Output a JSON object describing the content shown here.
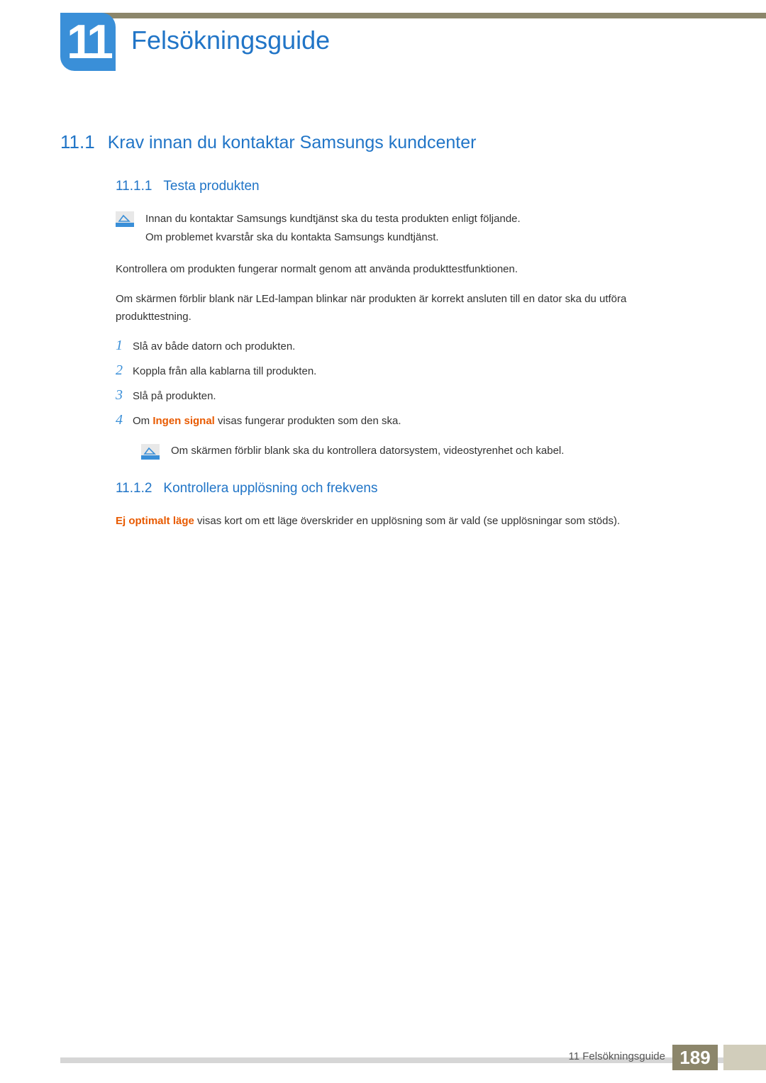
{
  "chapter": {
    "number": "11",
    "title": "Felsökningsguide"
  },
  "section": {
    "number": "11.1",
    "title": "Krav innan du kontaktar Samsungs kundcenter"
  },
  "subsection1": {
    "number": "11.1.1",
    "title": "Testa produkten",
    "note_line1": "Innan du kontaktar Samsungs kundtjänst ska du testa produkten enligt följande.",
    "note_line2": "Om problemet kvarstår ska du kontakta Samsungs kundtjänst.",
    "para1": "Kontrollera om produkten fungerar normalt genom att använda produkttestfunktionen.",
    "para2": "Om skärmen förblir blank när LEd-lampan blinkar när produkten är korrekt ansluten till en dator ska du utföra produkttestning.",
    "steps": [
      {
        "num": "1",
        "text": "Slå av både datorn och produkten."
      },
      {
        "num": "2",
        "text": "Koppla från alla kablarna till produkten."
      },
      {
        "num": "3",
        "text": "Slå på produkten."
      },
      {
        "num": "4",
        "text_before": "Om ",
        "highlight": "Ingen signal",
        "text_after": " visas fungerar produkten som den ska."
      }
    ],
    "sub_note": "Om skärmen förblir blank ska du kontrollera datorsystem, videostyrenhet och kabel."
  },
  "subsection2": {
    "number": "11.1.2",
    "title": "Kontrollera upplösning och frekvens",
    "para_highlight": "Ej optimalt läge",
    "para_rest": " visas kort om ett läge överskrider en upplösning som är vald (se upplösningar som stöds)."
  },
  "footer": {
    "chapter_label": "11 Felsökningsguide",
    "page": "189"
  }
}
